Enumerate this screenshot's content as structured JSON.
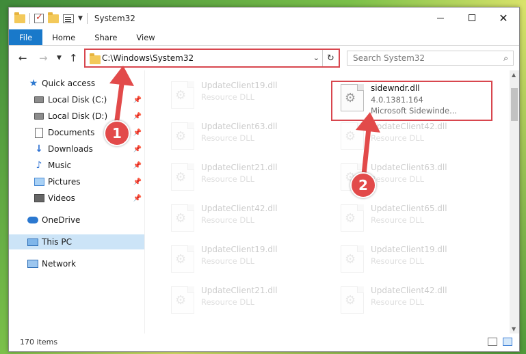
{
  "window": {
    "title": "System32",
    "controls": {
      "minimize": "—",
      "maximize": "☐",
      "close": "✕"
    }
  },
  "ribbon": {
    "tabs": [
      {
        "label": "File"
      },
      {
        "label": "Home"
      },
      {
        "label": "Share"
      },
      {
        "label": "View"
      }
    ]
  },
  "address": {
    "path": "C:\\Windows\\System32",
    "search_placeholder": "Search System32"
  },
  "sidebar": {
    "items": [
      {
        "label": "Quick access",
        "icon": "star-icon"
      },
      {
        "label": "Local Disk (C:)",
        "icon": "drive-icon",
        "pinned": true
      },
      {
        "label": "Local Disk (D:)",
        "icon": "drive-icon",
        "pinned": true
      },
      {
        "label": "Documents",
        "icon": "documents-icon",
        "pinned": true
      },
      {
        "label": "Downloads",
        "icon": "downloads-icon",
        "pinned": true
      },
      {
        "label": "Music",
        "icon": "music-icon",
        "pinned": true
      },
      {
        "label": "Pictures",
        "icon": "pictures-icon",
        "pinned": true
      },
      {
        "label": "Videos",
        "icon": "videos-icon",
        "pinned": true
      },
      {
        "label": "OneDrive",
        "icon": "onedrive-icon"
      },
      {
        "label": "This PC",
        "icon": "this-pc-icon",
        "selected": true
      },
      {
        "label": "Network",
        "icon": "network-icon"
      }
    ]
  },
  "files": {
    "left": [
      {
        "name": "UpdateClient19.dll",
        "type": "Resource DLL"
      },
      {
        "name": "UpdateClient63.dll",
        "type": "Resource DLL"
      },
      {
        "name": "UpdateClient21.dll",
        "type": "Resource DLL"
      },
      {
        "name": "UpdateClient42.dll",
        "type": "Resource DLL"
      },
      {
        "name": "UpdateClient19.dll",
        "type": "Resource DLL"
      },
      {
        "name": "UpdateClient21.dll",
        "type": "Resource DLL"
      }
    ],
    "right": [
      {
        "name": "UpdateClient42.dll",
        "type": "Resource DLL"
      },
      {
        "name": "UpdateClient63.dll",
        "type": "Resource DLL"
      },
      {
        "name": "UpdateClient65.dll",
        "type": "Resource DLL"
      },
      {
        "name": "UpdateClient19.dll",
        "type": "Resource DLL"
      },
      {
        "name": "UpdateClient42.dll",
        "type": "Resource DLL"
      }
    ],
    "highlighted": {
      "name": "sidewndr.dll",
      "version": "4.0.1381.164",
      "description": "Microsoft Sidewinde..."
    }
  },
  "status": {
    "item_count": "170 items"
  },
  "callouts": [
    {
      "label": "1"
    },
    {
      "label": "2"
    }
  ],
  "colors": {
    "accent": "#1979ca",
    "highlight_border": "#d8464e",
    "callout": "#e24a4a",
    "selected_bg": "#cce4f7"
  }
}
